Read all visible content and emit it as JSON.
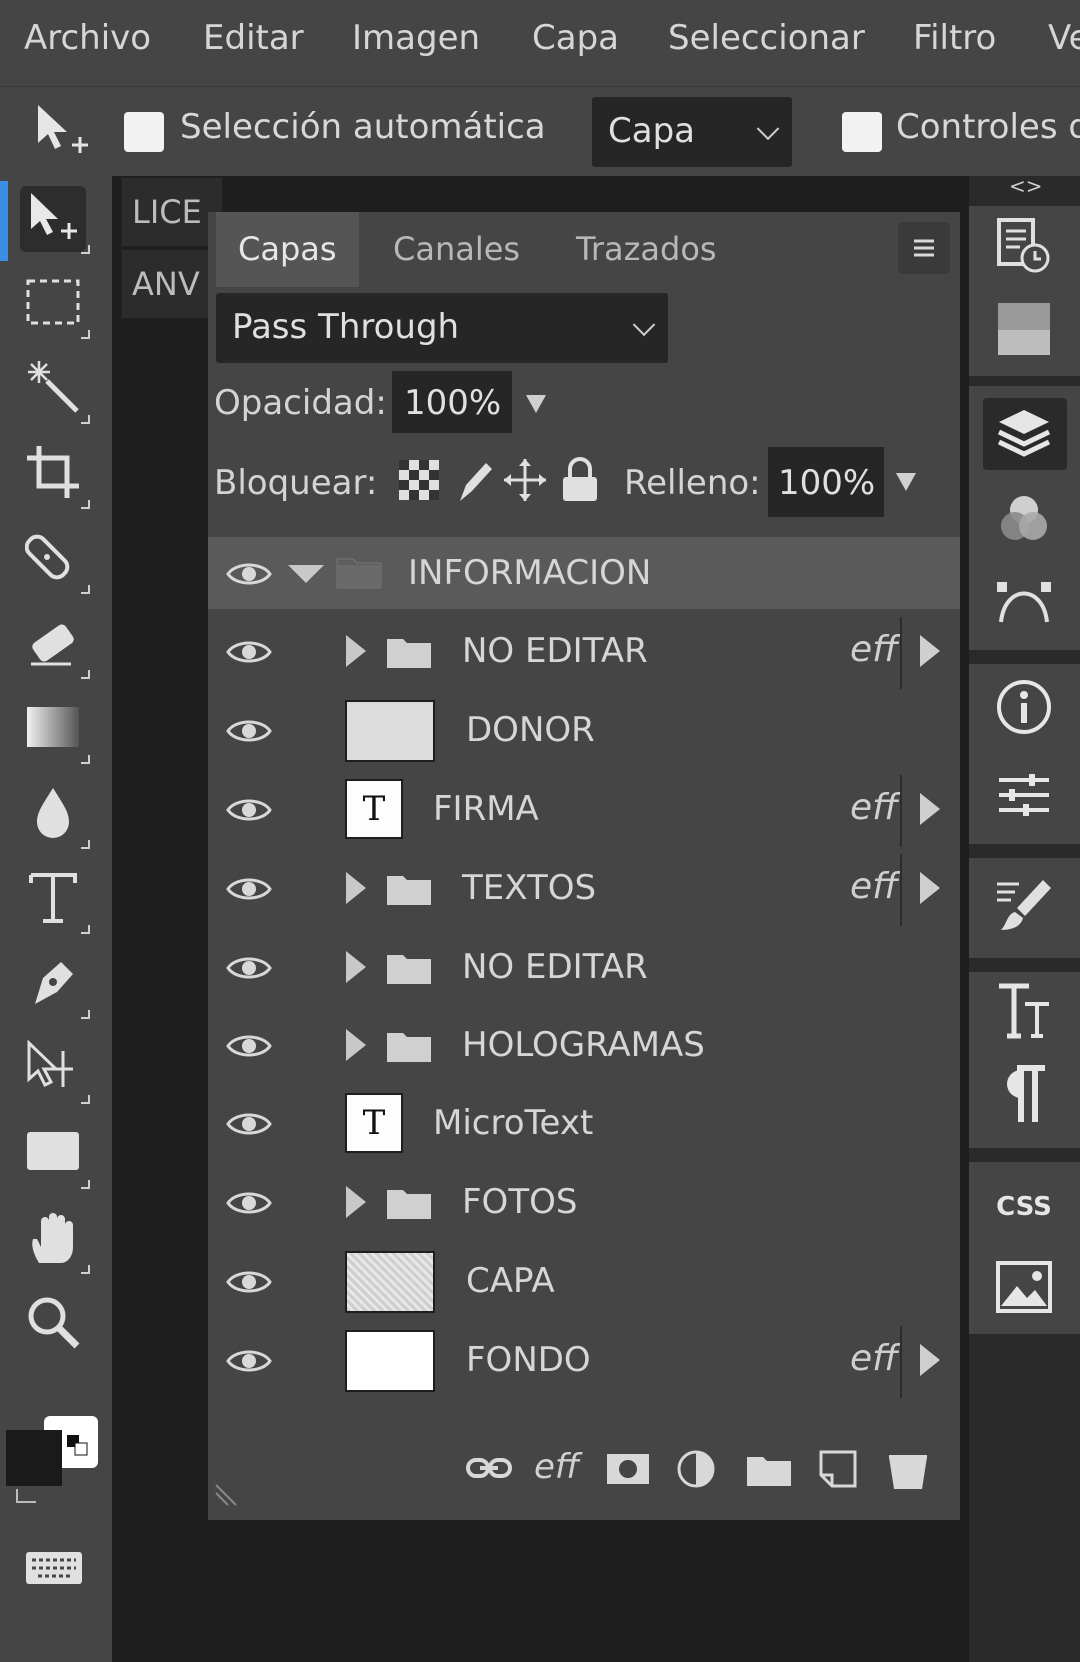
{
  "menu": [
    "Archivo",
    "Editar",
    "Imagen",
    "Capa",
    "Seleccionar",
    "Filtro",
    "Ve"
  ],
  "options": {
    "auto_select_label": "Selección automática",
    "auto_select_target": "Capa",
    "controls_label": "Controles d"
  },
  "dock_toggle": "<>",
  "documents": [
    "LICE",
    "ANV"
  ],
  "layers_panel": {
    "tabs": [
      "Capas",
      "Canales",
      "Trazados"
    ],
    "blend_mode": "Pass Through",
    "opacity_label": "Opacidad:",
    "opacity_value": "100%",
    "lock_label": "Bloquear:",
    "fill_label": "Relleno:",
    "fill_value": "100%",
    "effects_label": "eff",
    "layers": [
      {
        "name": "INFORMACION",
        "kind": "group-open",
        "selected": true
      },
      {
        "name": "NO EDITAR",
        "kind": "group",
        "effects": true
      },
      {
        "name": "DONOR",
        "kind": "image"
      },
      {
        "name": "FIRMA",
        "kind": "text",
        "effects": true
      },
      {
        "name": "TEXTOS",
        "kind": "group",
        "effects": true
      },
      {
        "name": "NO EDITAR",
        "kind": "group"
      },
      {
        "name": "HOLOGRAMAS",
        "kind": "group"
      },
      {
        "name": "MicroText",
        "kind": "text"
      },
      {
        "name": "FOTOS",
        "kind": "group"
      },
      {
        "name": "CAPA",
        "kind": "image-transparent"
      },
      {
        "name": "FONDO",
        "kind": "image-white",
        "effects": true
      }
    ],
    "text_thumb_glyph": "T",
    "footer_effects_label": "eff"
  },
  "icons": {
    "toolbar": [
      "move-icon",
      "marquee-icon",
      "magic-wand-icon",
      "crop-icon",
      "healing-icon",
      "eraser-icon",
      "gradient-icon",
      "blur-icon",
      "type-icon",
      "pen-icon",
      "path-select-icon",
      "rectangle-icon",
      "hand-icon",
      "zoom-icon"
    ],
    "dock": [
      "history-icon",
      "swatches-icon",
      "layers-icon",
      "channels-icon",
      "paths-icon",
      "info-icon",
      "adjustments-icon",
      "brush-settings-icon",
      "character-icon",
      "paragraph-icon",
      "css-icon",
      "image-icon"
    ]
  },
  "dock_css_label": "CSS",
  "colors": {
    "foreground": "#1a1a1a",
    "background": "#ffffff",
    "accent": "#3a8ee6"
  }
}
